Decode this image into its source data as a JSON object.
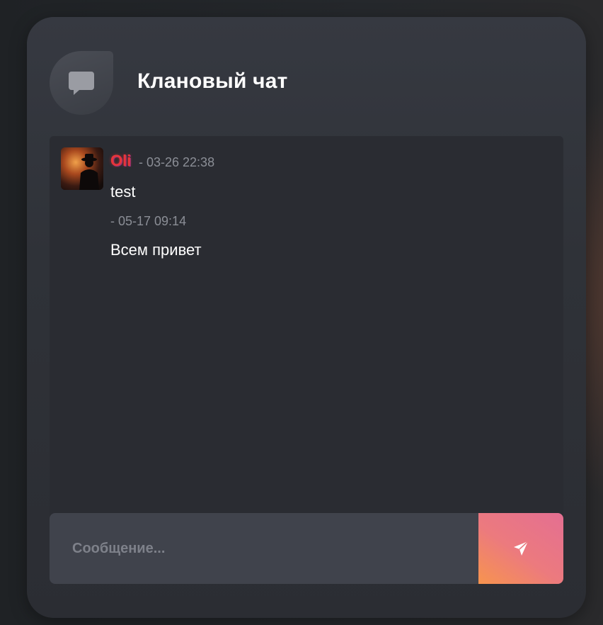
{
  "header": {
    "title": "Клановый чат",
    "icon": "chat-bubble-icon"
  },
  "messages": [
    {
      "username": "Oli",
      "meta": "- 03-26 22:38",
      "text": "test"
    },
    {
      "meta": "- 05-17 09:14",
      "text": "Всем привет"
    }
  ],
  "composer": {
    "placeholder": "Сообщение...",
    "value": "",
    "send_icon": "paper-plane-icon"
  },
  "colors": {
    "card_bg": "#30333a",
    "username": "#e8353a",
    "send_gradient_start": "#e46f92",
    "send_gradient_end": "#f7944e"
  }
}
